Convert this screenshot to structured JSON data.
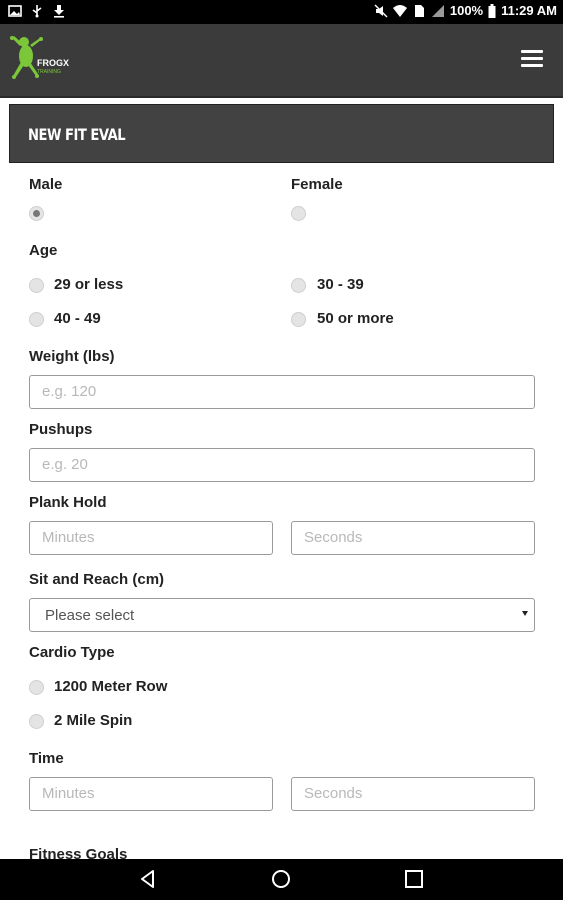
{
  "status_bar": {
    "battery": "100%",
    "time": "11:29 AM"
  },
  "header": {
    "logo_text": "FROGX",
    "logo_subtext": "TRAINING",
    "menu_icon": "hamburger-menu-icon"
  },
  "form": {
    "title": "NEW FIT EVAL",
    "gender": {
      "male_label": "Male",
      "female_label": "Female",
      "selected": "Male"
    },
    "age": {
      "label": "Age",
      "options": [
        "29 or less",
        "30 - 39",
        "40 - 49",
        "50 or more"
      ]
    },
    "weight": {
      "label": "Weight (lbs)",
      "placeholder": "e.g. 120",
      "value": ""
    },
    "pushups": {
      "label": "Pushups",
      "placeholder": "e.g. 20",
      "value": ""
    },
    "plank_hold": {
      "label": "Plank Hold",
      "minutes_placeholder": "Minutes",
      "seconds_placeholder": "Seconds"
    },
    "sit_and_reach": {
      "label": "Sit and Reach (cm)",
      "selected": "Please select"
    },
    "cardio_type": {
      "label": "Cardio Type",
      "options": [
        "1200 Meter Row",
        "2 Mile Spin"
      ]
    },
    "time": {
      "label": "Time",
      "minutes_placeholder": "Minutes",
      "seconds_placeholder": "Seconds"
    },
    "fitness_goals": {
      "label": "Fitness Goals"
    }
  },
  "colors": {
    "header_bg": "#3b3b3b",
    "card_header_bg": "#424242",
    "logo_green": "#7cc63a",
    "system_bar": "#000000"
  }
}
